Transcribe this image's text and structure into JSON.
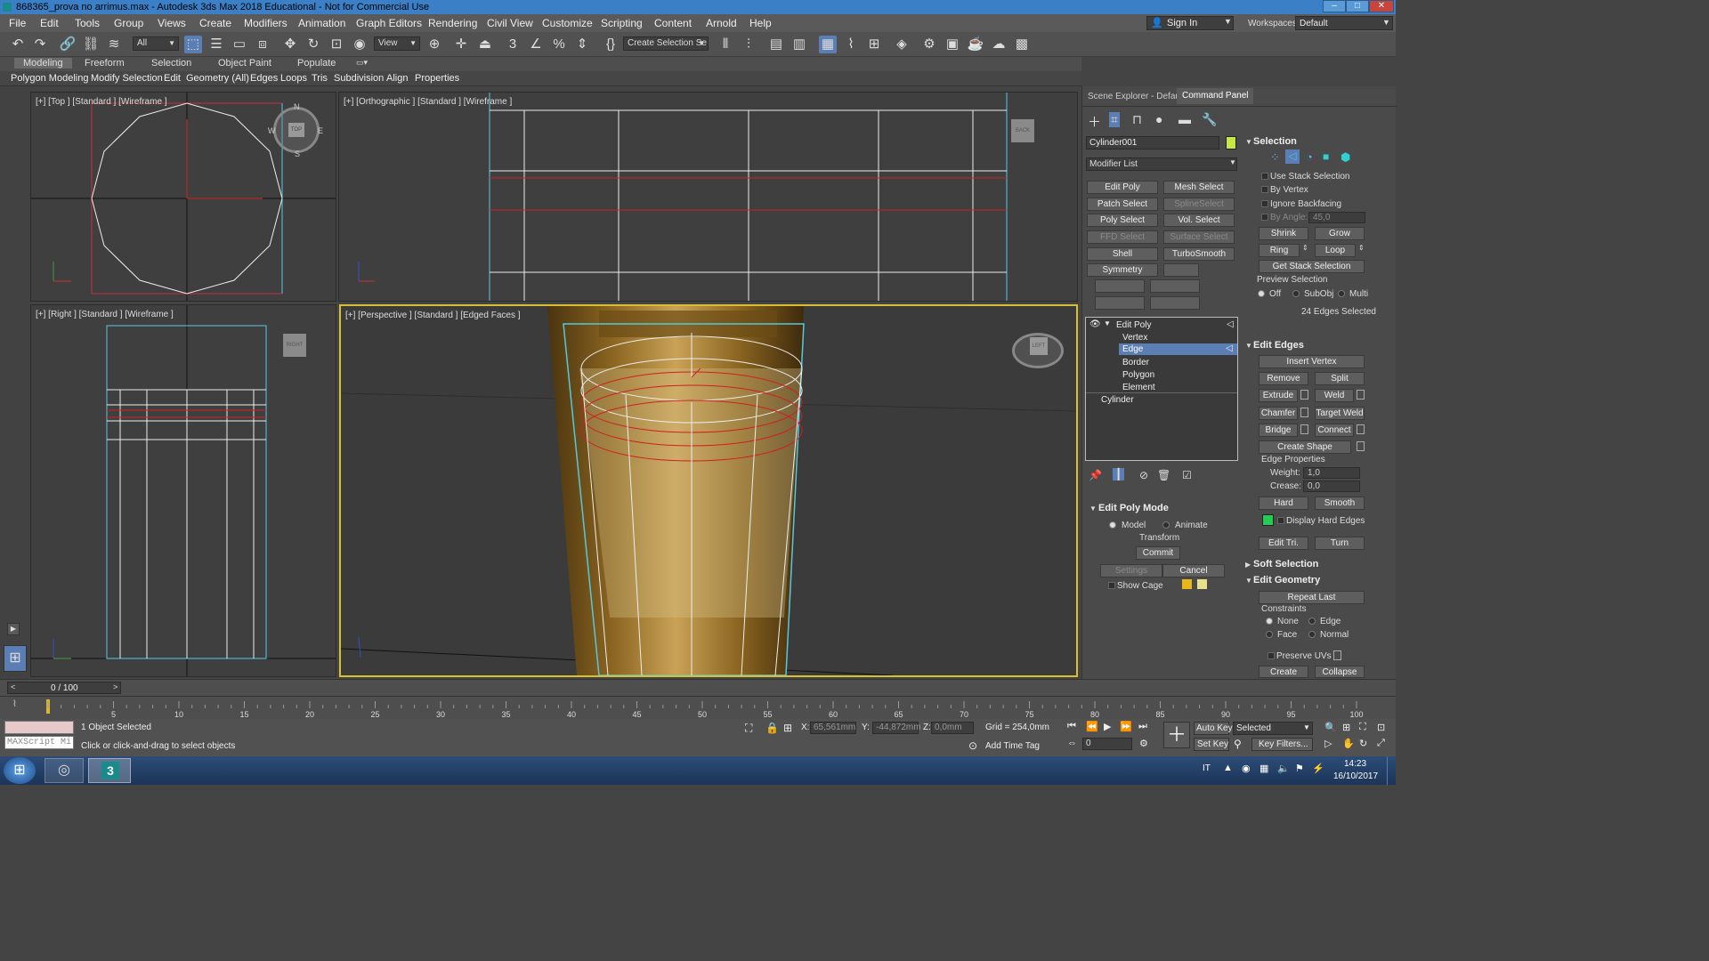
{
  "window": {
    "title": "868365_prova no arrimus.max - Autodesk 3ds Max 2018 Educational - Not for Commercial Use"
  },
  "menu": [
    "File",
    "Edit",
    "Tools",
    "Group",
    "Views",
    "Create",
    "Modifiers",
    "Animation",
    "Graph Editors",
    "Rendering",
    "Civil View",
    "Customize",
    "Scripting",
    "Content",
    "Arnold",
    "Help"
  ],
  "account": {
    "sign_in": "Sign In",
    "workspaces_label": "Workspaces:",
    "workspace": "Default"
  },
  "toolbar": {
    "filter": "All",
    "ref_coord": "View",
    "selection_set": "Create Selection Se"
  },
  "ribbon": {
    "tabs": [
      "Modeling",
      "Freeform",
      "Selection",
      "Object Paint",
      "Populate"
    ],
    "items": [
      "Polygon Modeling",
      "Modify Selection",
      "Edit",
      "Geometry (All)",
      "Edges",
      "Loops",
      "Tris",
      "Subdivision",
      "Align",
      "Properties"
    ]
  },
  "viewports": {
    "top": {
      "label": "[+] [Top ] [Standard ] [Wireframe ]",
      "cube": "TOP",
      "compass": {
        "n": "N",
        "s": "S",
        "e": "E",
        "w": "W"
      }
    },
    "ortho": {
      "label": "[+] [Orthographic ] [Standard ] [Wireframe ]",
      "cube": "BACK"
    },
    "right": {
      "label": "[+] [Right ] [Standard ] [Wireframe ]",
      "cube": "RIGHT"
    },
    "persp": {
      "label": "[+] [Perspective ] [Standard ] [Edged Faces ]",
      "cube": "LEFT"
    }
  },
  "command_panel": {
    "tabs": [
      "Scene Explorer - Default",
      "Command Panel"
    ],
    "object_name": "Cylinder001",
    "object_color": "#c8e646",
    "modifier_list": "Modifier List",
    "modifier_buttons": [
      [
        "Edit Poly",
        "Mesh Select"
      ],
      [
        "Patch Select",
        "SplineSelect"
      ],
      [
        "Poly Select",
        "Vol. Select"
      ],
      [
        "FFD Select",
        "Surface Select"
      ],
      [
        "Shell",
        "TurboSmooth"
      ],
      [
        "Symmetry",
        ""
      ]
    ],
    "stack": {
      "edit_poly": "Edit Poly",
      "subs": [
        "Vertex",
        "Edge",
        "Border",
        "Polygon",
        "Element"
      ],
      "base": "Cylinder"
    },
    "edit_poly_mode": {
      "title": "Edit Poly Mode",
      "model": "Model",
      "animate": "Animate",
      "transform": "Transform",
      "commit": "Commit",
      "settings": "Settings",
      "cancel": "Cancel",
      "show_cage": "Show Cage"
    },
    "selection": {
      "title": "Selection",
      "use_stack": "Use Stack Selection",
      "by_vertex": "By Vertex",
      "ignore_backfacing": "Ignore Backfacing",
      "by_angle": "By Angle:",
      "angle": "45,0",
      "shrink": "Shrink",
      "grow": "Grow",
      "ring": "Ring",
      "loop": "Loop",
      "get_stack": "Get Stack Selection",
      "preview": "Preview Selection",
      "off": "Off",
      "subobj": "SubObj",
      "multi": "Multi",
      "status": "24 Edges Selected"
    },
    "edit_edges": {
      "title": "Edit Edges",
      "insert_vertex": "Insert Vertex",
      "remove": "Remove",
      "split": "Split",
      "extrude": "Extrude",
      "weld": "Weld",
      "chamfer": "Chamfer",
      "target_weld": "Target Weld",
      "bridge": "Bridge",
      "connect": "Connect",
      "create_shape": "Create Shape",
      "props": "Edge Properties",
      "weight_label": "Weight:",
      "weight": "1,0",
      "crease_label": "Crease:",
      "crease": "0,0",
      "hard": "Hard",
      "smooth": "Smooth",
      "display_hard": "Display Hard Edges",
      "hard_color": "#22cc55",
      "edit_tri": "Edit Tri.",
      "turn": "Turn"
    },
    "soft_selection": "Soft Selection",
    "edit_geometry": {
      "title": "Edit Geometry",
      "repeat_last": "Repeat Last",
      "constraints": "Constraints",
      "none": "None",
      "edge": "Edge",
      "face": "Face",
      "normal": "Normal",
      "preserve_uvs": "Preserve UVs",
      "create": "Create",
      "collapse": "Collapse"
    }
  },
  "timeline": {
    "frame": "0 / 100",
    "ticks": [
      "5",
      "10",
      "15",
      "20",
      "25",
      "30",
      "35",
      "40",
      "45",
      "50",
      "55",
      "60",
      "65",
      "70",
      "75",
      "80",
      "85",
      "90",
      "95",
      "100"
    ]
  },
  "status": {
    "objects": "1 Object Selected",
    "prompt": "Click or click-and-drag to select objects",
    "maxscript": "MAXScript Mi",
    "x_label": "X:",
    "x": "65,561mm",
    "y_label": "Y:",
    "y": "-44,872mm",
    "z_label": "Z:",
    "z": "0,0mm",
    "grid": "Grid = 254,0mm",
    "add_time_tag": "Add Time Tag",
    "auto_key": "Auto Key",
    "set_key": "Set Key",
    "selected": "Selected",
    "key_filters": "Key Filters...",
    "frame_field": "0"
  },
  "taskbar": {
    "lang": "IT",
    "time": "14:23",
    "date": "16/10/2017",
    "app_badge": "3"
  }
}
